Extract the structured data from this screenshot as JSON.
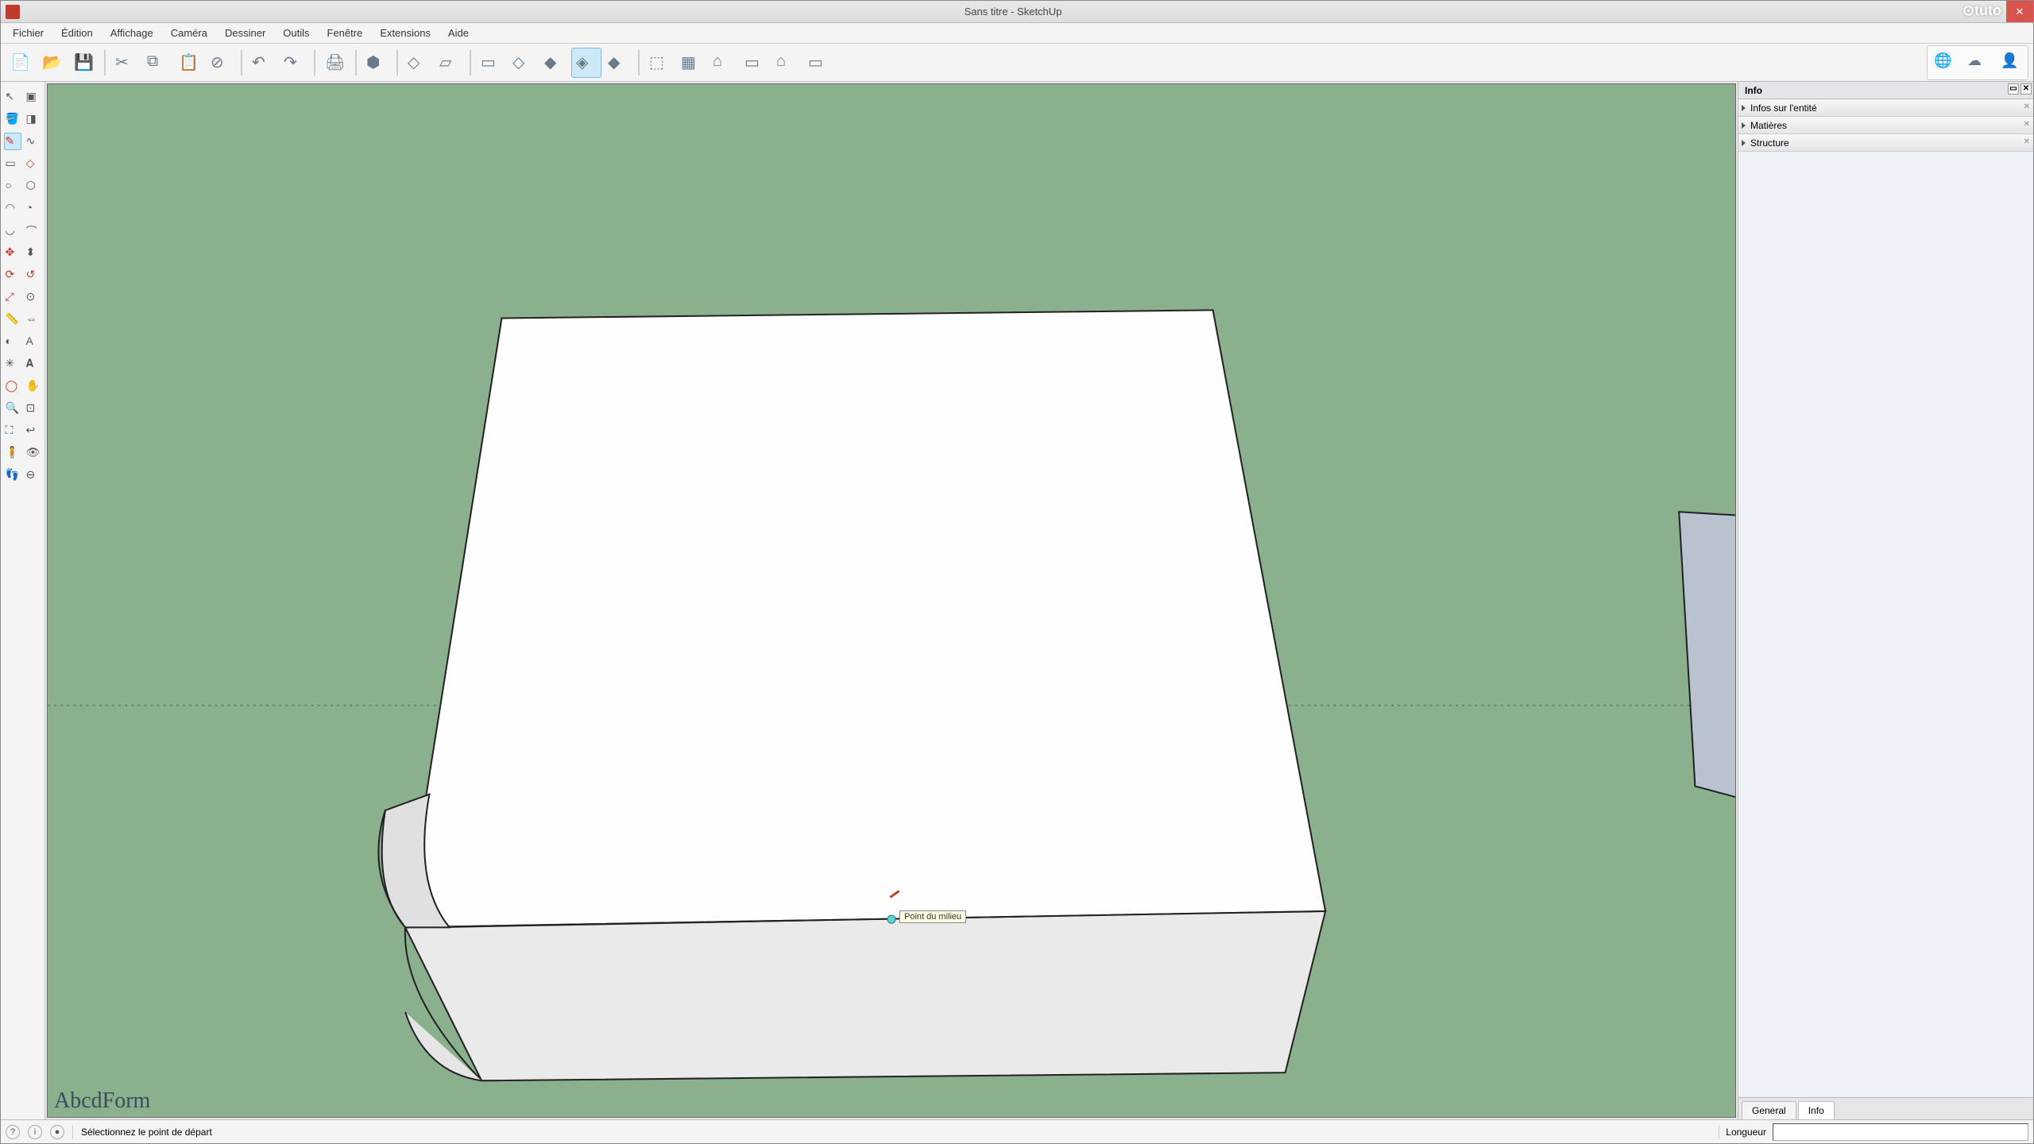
{
  "window": {
    "title": "Sans titre - SketchUp"
  },
  "menu": [
    "Fichier",
    "Édition",
    "Affichage",
    "Caméra",
    "Dessiner",
    "Outils",
    "Fenêtre",
    "Extensions",
    "Aide"
  ],
  "toolbar_main": [
    {
      "name": "new-file-icon",
      "glyph": "📄"
    },
    {
      "name": "open-file-icon",
      "glyph": "📂"
    },
    {
      "name": "save-icon",
      "glyph": "💾"
    },
    {
      "sep": true
    },
    {
      "name": "cut-icon",
      "glyph": "✂"
    },
    {
      "name": "copy-icon",
      "glyph": "⧉"
    },
    {
      "name": "paste-icon",
      "glyph": "📋"
    },
    {
      "name": "delete-icon",
      "glyph": "⊘"
    },
    {
      "sep": true
    },
    {
      "name": "undo-icon",
      "glyph": "↶"
    },
    {
      "name": "redo-icon",
      "glyph": "↷"
    },
    {
      "sep": true
    },
    {
      "name": "print-icon",
      "glyph": "🖨"
    },
    {
      "sep": true
    },
    {
      "name": "model-info-icon",
      "glyph": "⬢"
    },
    {
      "sep": true
    },
    {
      "name": "iso-icon",
      "glyph": "◇"
    },
    {
      "name": "top-icon",
      "glyph": "▱"
    },
    {
      "sep": true
    },
    {
      "name": "wireframe-icon",
      "glyph": "▭"
    },
    {
      "name": "hidden-line-icon",
      "glyph": "◇"
    },
    {
      "name": "shaded-icon",
      "glyph": "◆"
    },
    {
      "name": "shaded-tex-icon",
      "glyph": "◈",
      "active": true
    },
    {
      "name": "monochrome-icon",
      "glyph": "◆"
    },
    {
      "sep": true
    },
    {
      "name": "component-icon",
      "glyph": "⬚"
    },
    {
      "name": "group-icon",
      "glyph": "▦"
    },
    {
      "name": "house-icon",
      "glyph": "⌂"
    },
    {
      "name": "door-icon",
      "glyph": "▭"
    },
    {
      "name": "window-icon",
      "glyph": "⌂"
    },
    {
      "name": "wall-icon",
      "glyph": "▭"
    }
  ],
  "toolbar_right": [
    {
      "name": "geo-icon",
      "glyph": "🌐"
    },
    {
      "name": "cloud-icon",
      "glyph": "☁"
    },
    {
      "name": "user-icon",
      "glyph": "👤"
    }
  ],
  "left_tools": [
    [
      {
        "name": "select-icon",
        "g": "↖"
      },
      {
        "name": "make-component-icon",
        "g": "▣"
      }
    ],
    [
      {
        "name": "paint-bucket-icon",
        "g": "🪣"
      },
      {
        "name": "eraser-icon",
        "g": "◨"
      }
    ],
    [
      {
        "name": "line-icon",
        "g": "✎",
        "active": true
      },
      {
        "name": "freehand-icon",
        "g": "∿"
      }
    ],
    [
      {
        "name": "rectangle-icon",
        "g": "▭"
      },
      {
        "name": "rotated-rect-icon",
        "g": "◇"
      }
    ],
    [
      {
        "name": "circle-icon",
        "g": "○"
      },
      {
        "name": "polygon-icon",
        "g": "⬡"
      }
    ],
    [
      {
        "name": "arc-icon",
        "g": "◠"
      },
      {
        "name": "pie-icon",
        "g": "◔"
      }
    ],
    [
      {
        "name": "arc2-icon",
        "g": "◡"
      },
      {
        "name": "arc3-icon",
        "g": "⌒"
      }
    ],
    [
      {
        "name": "move-icon",
        "g": "✥"
      },
      {
        "name": "pushpull-icon",
        "g": "⬍"
      }
    ],
    [
      {
        "name": "rotate-icon",
        "g": "⟳"
      },
      {
        "name": "followme-icon",
        "g": "↺"
      }
    ],
    [
      {
        "name": "scale-icon",
        "g": "⤢"
      },
      {
        "name": "offset-icon",
        "g": "⊙"
      }
    ],
    [
      {
        "name": "tape-icon",
        "g": "📏"
      },
      {
        "name": "dimension-icon",
        "g": "⇔"
      }
    ],
    [
      {
        "name": "protractor-icon",
        "g": "◐"
      },
      {
        "name": "text-icon",
        "g": "A"
      }
    ],
    [
      {
        "name": "axes-icon",
        "g": "✳"
      },
      {
        "name": "3dtext-icon",
        "g": "𝐀"
      }
    ],
    [
      {
        "name": "orbit-icon",
        "g": "◯"
      },
      {
        "name": "pan-icon",
        "g": "✋"
      }
    ],
    [
      {
        "name": "zoom-icon",
        "g": "🔍"
      },
      {
        "name": "zoom-window-icon",
        "g": "⊡"
      }
    ],
    [
      {
        "name": "zoom-extents-icon",
        "g": "⛶"
      },
      {
        "name": "previous-icon",
        "g": "↩"
      }
    ],
    [
      {
        "name": "position-camera-icon",
        "g": "🧍"
      },
      {
        "name": "look-around-icon",
        "g": "👁"
      }
    ],
    [
      {
        "name": "walk-icon",
        "g": "👣"
      },
      {
        "name": "section-icon",
        "g": "⊖"
      }
    ]
  ],
  "viewport": {
    "tooltip": "Point du milieu",
    "watermark": "AbcdForm"
  },
  "right_panel": {
    "title": "Info",
    "sections": [
      "Infos sur l'entité",
      "Matières",
      "Structure"
    ],
    "tabs": [
      "General",
      "Info"
    ],
    "active_tab": 1
  },
  "status": {
    "hint": "Sélectionnez le point de départ",
    "measure_label": "Longueur"
  }
}
